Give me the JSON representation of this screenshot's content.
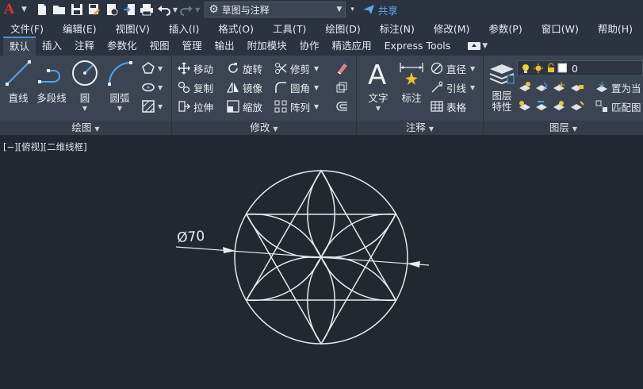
{
  "quick_access": {
    "workspace": "草图与注释",
    "share_label": "共享"
  },
  "menubar": {
    "items": [
      "文件(F)",
      "编辑(E)",
      "视图(V)",
      "插入(I)",
      "格式(O)",
      "工具(T)",
      "绘图(D)",
      "标注(N)",
      "修改(M)",
      "参数(P)",
      "窗口(W)",
      "帮助(H)"
    ]
  },
  "tabs": {
    "items": [
      "默认",
      "插入",
      "注释",
      "参数化",
      "视图",
      "管理",
      "输出",
      "附加模块",
      "协作",
      "精选应用",
      "Express Tools"
    ],
    "active": "默认"
  },
  "ribbon": {
    "draw": {
      "title": "绘图",
      "line": "直线",
      "polyline": "多段线",
      "circle": "圆",
      "arc": "圆弧"
    },
    "modify": {
      "title": "修改",
      "move": "移动",
      "rotate": "旋转",
      "trim": "修剪",
      "copy": "复制",
      "mirror": "镜像",
      "fillet": "圆角",
      "stretch": "拉伸",
      "scale": "缩放",
      "array": "阵列"
    },
    "annotation": {
      "title": "注释",
      "text": "文字",
      "dimension": "标注",
      "diameter": "直径",
      "leader": "引线",
      "table": "表格"
    },
    "layers": {
      "title": "图层",
      "properties_line1": "图层",
      "properties_line2": "特性",
      "current_layer": "0",
      "make_current": "置为当",
      "match_layer": "匹配图"
    }
  },
  "viewport": {
    "label": "[−][俯视][二维线框]",
    "dimension_text": "Ø70"
  },
  "colors": {
    "drawing_line": "#e8eaec",
    "background": "#212830",
    "ribbon": "#3b4453",
    "accent_blue": "#4a90d9",
    "share_blue": "#5ca8f0",
    "logo_red": "#d9322a"
  }
}
